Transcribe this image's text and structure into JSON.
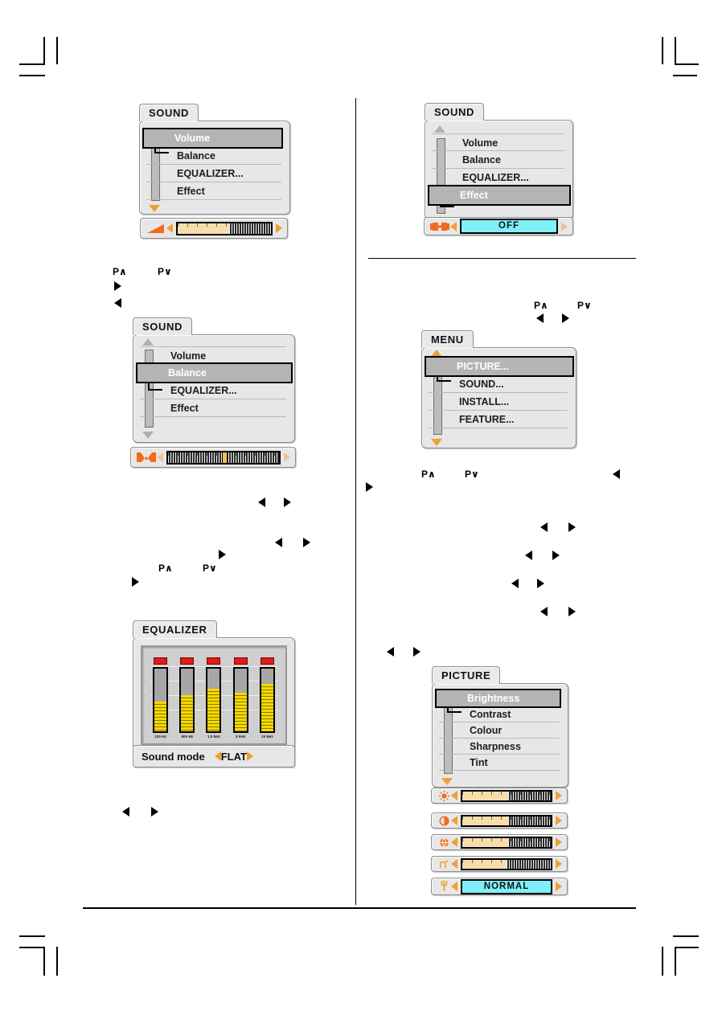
{
  "page": {
    "background": "#ffffff",
    "divider_color": "#000000"
  },
  "panels": {
    "sound_volume": {
      "tab": "SOUND",
      "items": [
        {
          "label": "Volume",
          "selected": true
        },
        {
          "label": "Balance",
          "selected": false
        },
        {
          "label": "EQUALIZER...",
          "selected": false
        },
        {
          "label": "Effect",
          "selected": false
        }
      ],
      "slider": {
        "icon": "volume-wedge-icon",
        "fill_percent": 55,
        "type": "bar"
      }
    },
    "sound_effect": {
      "tab": "SOUND",
      "items": [
        {
          "label": "Volume",
          "selected": false
        },
        {
          "label": "Balance",
          "selected": false
        },
        {
          "label": "EQUALIZER...",
          "selected": false
        },
        {
          "label": "Effect",
          "selected": true
        }
      ],
      "slider": {
        "icon": "effect-icon",
        "value": "OFF",
        "type": "value"
      }
    },
    "sound_balance": {
      "tab": "SOUND",
      "items": [
        {
          "label": "Volume",
          "selected": false
        },
        {
          "label": "Balance",
          "selected": true
        },
        {
          "label": "EQUALIZER...",
          "selected": false
        },
        {
          "label": "Effect",
          "selected": false
        }
      ],
      "slider": {
        "icon": "balance-icon",
        "knob_percent": 50,
        "type": "centered"
      }
    },
    "equalizer": {
      "tab": "EQUALIZER",
      "bands": [
        {
          "label": "120 Hz",
          "level": 48
        },
        {
          "label": "500 Hz",
          "level": 58
        },
        {
          "label": "1.5 kHz",
          "level": 68
        },
        {
          "label": "5 kHz",
          "level": 62
        },
        {
          "label": "10 kHz",
          "level": 76
        }
      ],
      "sound_mode": {
        "label": "Sound mode",
        "value": "FLAT"
      }
    },
    "menu": {
      "tab": "MENU",
      "items": [
        {
          "label": "PICTURE...",
          "selected": true
        },
        {
          "label": "SOUND...",
          "selected": false
        },
        {
          "label": "INSTALL...",
          "selected": false
        },
        {
          "label": "FEATURE...",
          "selected": false
        }
      ]
    },
    "picture": {
      "tab": "PICTURE",
      "items": [
        {
          "label": "Brightness",
          "selected": true
        },
        {
          "label": "Contrast",
          "selected": false
        },
        {
          "label": "Colour",
          "selected": false
        },
        {
          "label": "Sharpness",
          "selected": false
        },
        {
          "label": "Tint",
          "selected": false
        }
      ],
      "sliders": [
        {
          "icon": "brightness-sun-icon",
          "fill_percent": 52,
          "type": "bar"
        },
        {
          "icon": "contrast-half-circle-icon",
          "fill_percent": 52,
          "type": "bar"
        },
        {
          "icon": "colour-globe-icon",
          "fill_percent": 52,
          "type": "bar"
        },
        {
          "icon": "sharpness-step-icon",
          "fill_percent": 50,
          "type": "bar"
        },
        {
          "icon": "tint-key-icon",
          "value": "NORMAL",
          "type": "value"
        }
      ]
    }
  },
  "key_markers": {
    "p_up": "P∧",
    "p_down": "P∨",
    "left": "◀",
    "right": "▶"
  },
  "colors": {
    "highlight_row": "#b4b4b4",
    "panel": "#e7e7e7",
    "accent_orange": "#f0a030",
    "value_cyan": "#7ff0f7",
    "eq_yellow": "#f5d800",
    "eq_led_red": "#e01b1b"
  }
}
